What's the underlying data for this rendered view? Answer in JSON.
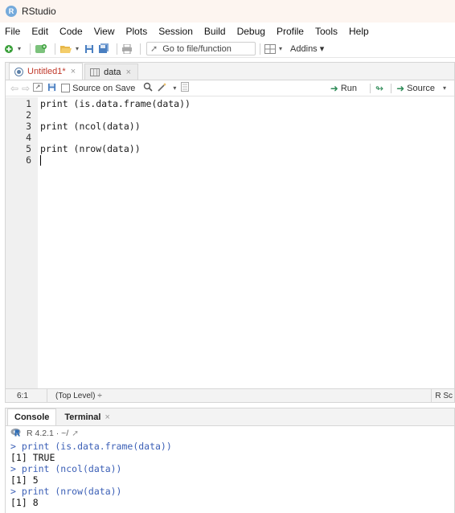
{
  "window": {
    "title": "RStudio",
    "logo_letter": "R"
  },
  "menu": [
    "File",
    "Edit",
    "Code",
    "View",
    "Plots",
    "Session",
    "Build",
    "Debug",
    "Profile",
    "Tools",
    "Help"
  ],
  "toolbar": {
    "goto_placeholder": "Go to file/function",
    "addins_label": "Addins"
  },
  "editor": {
    "tabs": [
      {
        "label": "Untitled1*",
        "active": true
      },
      {
        "label": "data",
        "active": false
      }
    ],
    "source_on_save_label": "Source on Save",
    "run_label": "Run",
    "source_label": "Source",
    "line_numbers": [
      "1",
      "2",
      "3",
      "4",
      "5",
      "6"
    ],
    "lines": [
      "print (is.data.frame(data))",
      "",
      "print (ncol(data))",
      "",
      "print (nrow(data))",
      ""
    ],
    "status": {
      "position": "6:1",
      "scope": "(Top Level) ÷",
      "file_type": "R Sc"
    }
  },
  "console": {
    "tabs": [
      {
        "label": "Console",
        "active": true
      },
      {
        "label": "Terminal",
        "active": false
      }
    ],
    "r_version": "R 4.2.1 · ~/",
    "output": [
      {
        "text": "> print (is.data.frame(data))",
        "kind": "cmd"
      },
      {
        "text": "[1] TRUE",
        "kind": "res"
      },
      {
        "text": "> print (ncol(data))",
        "kind": "cmd"
      },
      {
        "text": "[1] 5",
        "kind": "res"
      },
      {
        "text": "> print (nrow(data))",
        "kind": "cmd"
      },
      {
        "text": "[1] 8",
        "kind": "res"
      }
    ]
  }
}
